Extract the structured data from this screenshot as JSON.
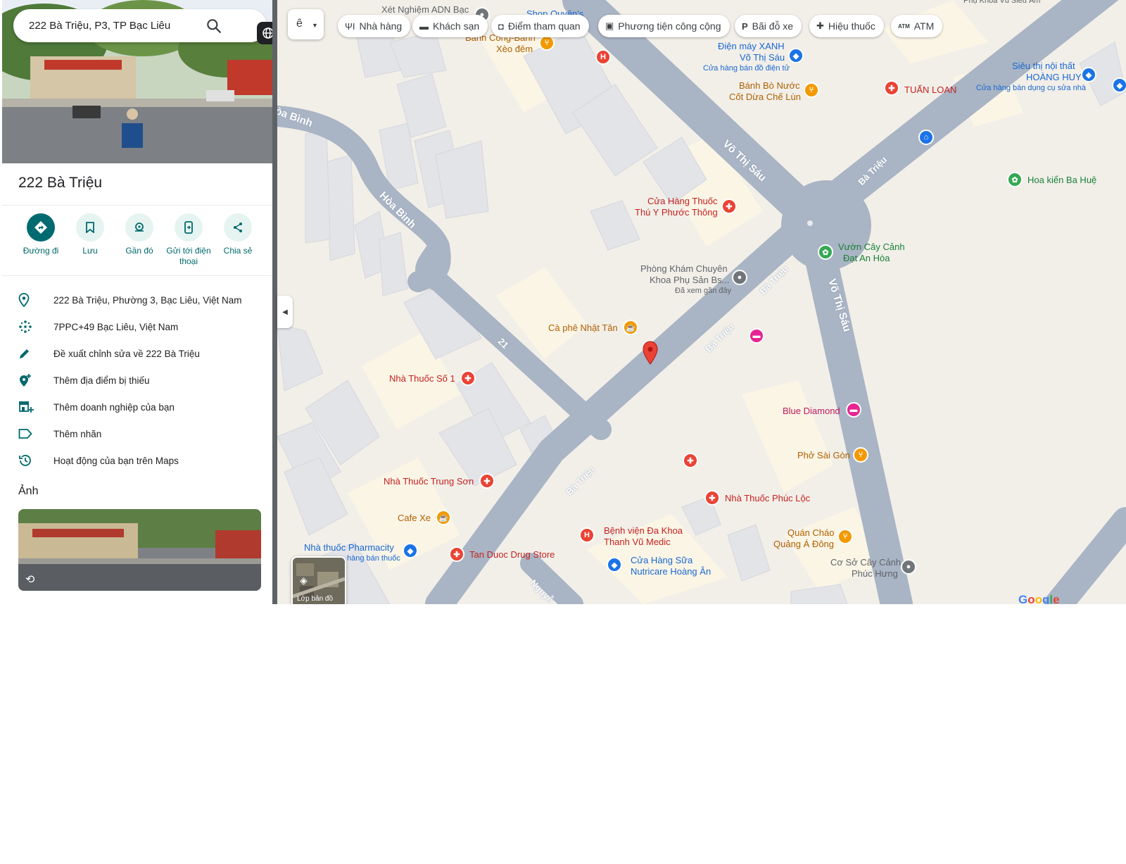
{
  "search": {
    "query": "222 Bà Triệu, P3, TP Bạc Liêu"
  },
  "place": {
    "title": "222 Bà Triệu"
  },
  "actions": [
    {
      "label": "Đường đi",
      "icon": "directions-icon"
    },
    {
      "label": "Lưu",
      "icon": "bookmark-icon"
    },
    {
      "label": "Gần đó",
      "icon": "nearby-icon"
    },
    {
      "label": "Gửi tới điện thoại",
      "icon": "send-to-phone-icon"
    },
    {
      "label": "Chia sẻ",
      "icon": "share-icon"
    }
  ],
  "info": [
    {
      "text": "222 Bà Triệu, Phường 3, Bạc Liêu, Việt Nam",
      "icon": "location-pin-icon"
    },
    {
      "text": "7PPC+49 Bạc Liêu, Việt Nam",
      "icon": "plus-code-icon"
    },
    {
      "text": "Đề xuất chỉnh sửa về 222 Bà Triệu",
      "icon": "edit-pencil-icon"
    },
    {
      "text": "Thêm địa điểm bị thiếu",
      "icon": "add-place-icon"
    },
    {
      "text": "Thêm doanh nghiệp của bạn",
      "icon": "add-business-icon"
    },
    {
      "text": "Thêm nhãn",
      "icon": "label-icon"
    },
    {
      "text": "Hoạt động của bạn trên Maps",
      "icon": "history-icon"
    }
  ],
  "photos": {
    "heading": "Ảnh"
  },
  "map_controls": {
    "layer_glyph": "ê",
    "chips": [
      {
        "label": "Nhà hàng",
        "icon": "restaurant-icon"
      },
      {
        "label": "Khách sạn",
        "icon": "hotel-icon"
      },
      {
        "label": "Điểm tham quan",
        "icon": "camera-icon"
      },
      {
        "label": "Phương tiện công cộng",
        "icon": "transit-icon"
      },
      {
        "label": "Bãi đỗ xe",
        "icon": "parking-icon"
      },
      {
        "label": "Hiệu thuốc",
        "icon": "pharmacy-icon"
      },
      {
        "label": "ATM",
        "icon": "atm-icon"
      }
    ],
    "layers_label": "Lớp bản đồ"
  },
  "map": {
    "roads": {
      "hoa_binh_1": "òa Bình",
      "hoa_binh_2": "Hòa Bình",
      "vo_thi_sau_1": "Võ Thị Sáu",
      "vo_thi_sau_2": "Võ Thị Sáu",
      "ba_trieu_1": "Bà Triệu",
      "ba_trieu_2": "Bà Triệu",
      "ba_trieu_3": "Bà Triệu",
      "ba_trieu_4": "Bà Triệu",
      "road_21": "21",
      "nguyen": "Nguyễ"
    },
    "pois": {
      "xet_nghiem": "Xét Nghiệm ADN Bạc",
      "shop": "Shop Quyên's",
      "banh_cong": "Bánh Cống-Bánh",
      "xeo_dem": "Xèo đêm",
      "dien_may_1": "Điện máy XANH",
      "dien_may_2": "Võ Thị Sáu",
      "dien_may_sub": "Cửa hàng bán đồ điện tử",
      "banh_bo_1": "Bánh Bò Nước",
      "banh_bo_2": "Cốt Dừa Chế Lùn",
      "tuan_loan": "TUẤN LOAN",
      "sieu_thi_1": "Siêu thị nội thất",
      "sieu_thi_2": "HOÀNG HUY",
      "sieu_thi_sub": "Cửa hàng bán dụng cụ sửa nhà",
      "hoa_kien": "Hoa kiển Ba Huệ",
      "cua_hang_thuoc_1": "Cửa Hàng Thuốc",
      "cua_hang_thuoc_2": "Thú Y Phước Thông",
      "vuon_1": "Vườn Cây Cảnh",
      "vuon_2": "Đạt An Hòa",
      "phong_kham_1": "Phòng Khám Chuyên",
      "phong_kham_2": "Khoa Phụ Sản Bs...",
      "phong_kham_sub": "Đã xem gần đây",
      "ca_phe": "Cà phê Nhật Tân",
      "nha_thuoc_so1": "Nhà Thuốc Số 1",
      "blue_diamond": "Blue Diamond",
      "pho_sai_gon": "Phở Sài Gòn",
      "nha_thuoc_trung_son": "Nhà Thuốc Trung Sơn",
      "phuc_loc": "Nhà Thuốc Phúc Lộc",
      "cafe_xe": "Cafe Xe",
      "benh_vien_1": "Bệnh viện Đa Khoa",
      "benh_vien_2": "Thanh Vũ Medic",
      "quan_chao_1": "Quán Cháo",
      "quan_chao_2": "Quảng Á Đông",
      "pharmacity": "Nhà thuốc Pharmacity",
      "pharmacity_sub": "hàng bán thuốc",
      "tan_duoc": "Tan Duoc Drug Store",
      "sua_1": "Cửa Hàng Sữa",
      "sua_2": "Nutricare Hoàng Ân",
      "co_so_1": "Cơ Sở Cây Cảnh",
      "co_so_2": "Phúc Hưng",
      "top_right": "Phụ Khoa Vũ Siêu Âm"
    },
    "logo": "Google"
  },
  "colors": {
    "accent": "#006a71",
    "map_bg": "#f2efe9",
    "road": "#a9b4c4",
    "block": "#dfe1e6",
    "poi_red": "#e8453c",
    "poi_orange": "#f29900",
    "poi_blue": "#1a73e8",
    "poi_pink": "#e52592",
    "poi_green": "#34a853"
  }
}
